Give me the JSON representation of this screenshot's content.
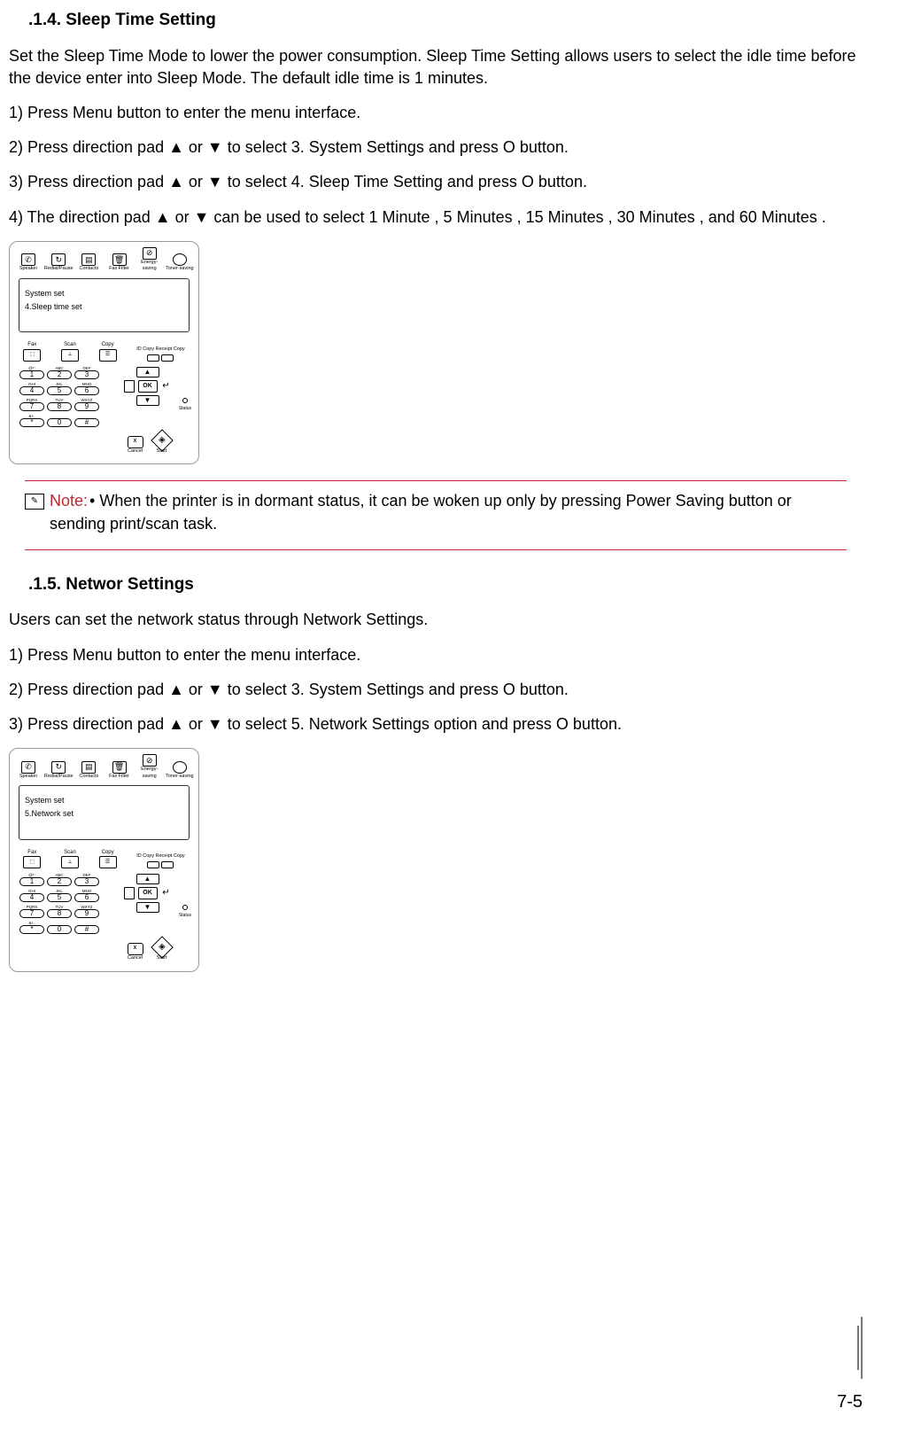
{
  "section1": {
    "heading": ".1.4. Sleep Time Setting",
    "intro": "Set the Sleep Time Mode to lower the power consumption.  Sleep Time Setting  allows users to select the idle time before the device enter into Sleep Mode. The default idle time is 1 minutes.",
    "step1": "1) Press  Menu  button to enter the menu interface.",
    "step2": "2) Press direction pad  ▲  or  ▼  to select  3. System Settings  and press  O     button.",
    "step3": "3) Press direction pad  ▲  or  ▼  to select  4. Sleep Time Setting  and press O   button.",
    "step4": "4) The direction pad  ▲  or  ▼  can be used to select  1 Minute ,  5 Minutes ,  15 Minutes ,  30 Minutes , and  60 Minutes ."
  },
  "section2": {
    "heading": ".1.5. Networ   Settings",
    "intro": "Users can set the network status through Network Settings.",
    "step1": "1) Press  Menu  button to enter the menu interface.",
    "step2": "2) Press direction pad  ▲  or  ▼  to select  3. System Settings  and press  O     button.",
    "step3": "3) Press direction pad  ▲  or  ▼  to select  5. Network Settings  option and press  O     button."
  },
  "note": {
    "label": "Note:",
    "text": "• When the printer is in dormant status, it can be woken up only by pressing Power Saving button or sending print/scan task."
  },
  "device": {
    "top": {
      "speaker": "Speaker",
      "redial": "Redial/Pause",
      "contacts": "Contacts",
      "faxfilter": "Fax Filter",
      "energysaving": "Energy-saving",
      "tonersaving": "Toner-saving"
    },
    "mid": {
      "fax": "Fax",
      "scan": "Scan",
      "copy": "Copy",
      "idcopy": "ID Copy",
      "receiptcopy": "Receipt Copy"
    },
    "lcd1": {
      "line1": "System set",
      "line2": "4.Sleep time set"
    },
    "lcd2": {
      "line1": "System set",
      "line2": "5.Network set"
    },
    "keypad": {
      "k1": "1",
      "s1": "@*:",
      "k2": "2",
      "s2": "ABC",
      "k3": "3",
      "s3": "DEF",
      "k4": "4",
      "s4": "GHI",
      "k5": "5",
      "s5": "JKL",
      "k6": "6",
      "s6": "MNO",
      "k7": "7",
      "s7": "PQRS",
      "k8": "8",
      "s8": "TUV",
      "k9": "9",
      "s9": "WXYZ",
      "kstar": "*",
      "sstar": "&+.",
      "k0": "0",
      "khash": "#"
    },
    "ok": "OK",
    "status": "Status",
    "cancel": "Cancel",
    "start": "Start",
    "cancelX": "X"
  },
  "page_number": "7-5"
}
